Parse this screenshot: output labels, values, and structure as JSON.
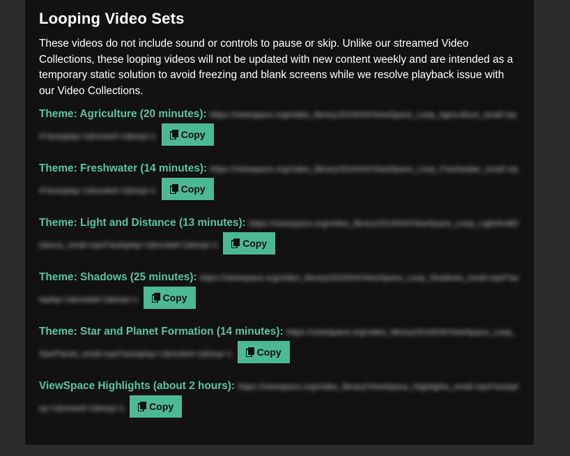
{
  "page": {
    "title": "Looping Video Sets",
    "intro": "These videos do not include sound or controls to pause or skip. Unlike our streamed Video Collections, these looping videos will not be updated with new content weekly and are intended as a temporary static solution to avoid freezing and blank screens while we resolve playback issue with our Video Collections."
  },
  "entries": [
    {
      "label": "Theme: Agriculture (20 minutes):",
      "url": "https://viewspace.org/video_library/2019/04/ViewSpace_Loop_Agriculture_small.mp4?autoplay=1&muted=1&loop=1",
      "copy_label": "Copy"
    },
    {
      "label": "Theme: Freshwater (14 minutes):",
      "url": "https://viewspace.org/video_library/2019/04/ViewSpace_Loop_Freshwater_small.mp4?autoplay=1&muted=1&loop=1",
      "copy_label": "Copy"
    },
    {
      "label": "Theme: Light and Distance (13 minutes):",
      "url": "https://viewspace.org/video_library/2019/04/ViewSpace_Loop_LightAndDistance_small.mp4?autoplay=1&muted=1&loop=1",
      "copy_label": "Copy"
    },
    {
      "label": "Theme: Shadows (25 minutes):",
      "url": "https://viewspace.org/video_library/2019/04/ViewSpace_Loop_Shadows_small.mp4?autoplay=1&muted=1&loop=1",
      "copy_label": "Copy"
    },
    {
      "label": "Theme: Star and Planet Formation (14 minutes):",
      "url": "https://viewspace.org/video_library/2019/04/ViewSpace_Loop_StarPlanet_small.mp4?autoplay=1&muted=1&loop=1",
      "copy_label": "Copy"
    },
    {
      "label": "ViewSpace Highlights (about 2 hours):",
      "url": "https://viewspace.org/video_library/ViewSpace_Highlights_small.mp4?autoplay=1&muted=1&loop=1",
      "copy_label": "Copy"
    }
  ],
  "icons": {
    "copy": "copy-icon"
  },
  "colors": {
    "accent": "#4db894",
    "label": "#5bc39c",
    "panel": "#121212",
    "background": "#2b2b2b"
  }
}
